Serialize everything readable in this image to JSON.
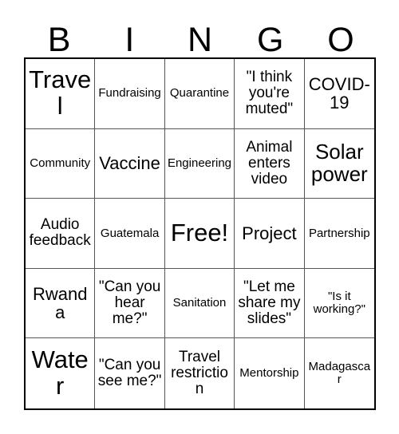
{
  "card": {
    "header_letters": [
      "B",
      "I",
      "N",
      "G",
      "O"
    ],
    "colors": {
      "background": "#ffffff",
      "text": "#000000",
      "outer_border": "#000000",
      "inner_border": "#555555"
    },
    "rows": [
      [
        {
          "text": "Travel",
          "size": "xxl"
        },
        {
          "text": "Fundraising",
          "size": "s"
        },
        {
          "text": "Quarantine",
          "size": "s"
        },
        {
          "text": "\"I think you're muted\"",
          "size": "m"
        },
        {
          "text": "COVID-19",
          "size": "l"
        }
      ],
      [
        {
          "text": "Community",
          "size": "s"
        },
        {
          "text": "Vaccine",
          "size": "l"
        },
        {
          "text": "Engineering",
          "size": "s"
        },
        {
          "text": "Animal enters video",
          "size": "m"
        },
        {
          "text": "Solar power",
          "size": "xl"
        }
      ],
      [
        {
          "text": "Audio feedback",
          "size": "m"
        },
        {
          "text": "Guatemala",
          "size": "s"
        },
        {
          "text": "Free!",
          "size": "xxl"
        },
        {
          "text": "Project",
          "size": "l"
        },
        {
          "text": "Partnership",
          "size": "s"
        }
      ],
      [
        {
          "text": "Rwanda",
          "size": "l"
        },
        {
          "text": "\"Can you hear me?\"",
          "size": "m"
        },
        {
          "text": "Sanitation",
          "size": "s"
        },
        {
          "text": "\"Let me share my slides\"",
          "size": "m"
        },
        {
          "text": "\"Is it working?\"",
          "size": "s"
        }
      ],
      [
        {
          "text": "Water",
          "size": "xxl"
        },
        {
          "text": "\"Can you see me?\"",
          "size": "m"
        },
        {
          "text": "Travel restriction",
          "size": "m"
        },
        {
          "text": "Mentorship",
          "size": "s"
        },
        {
          "text": "Madagascar",
          "size": "s"
        }
      ]
    ]
  }
}
